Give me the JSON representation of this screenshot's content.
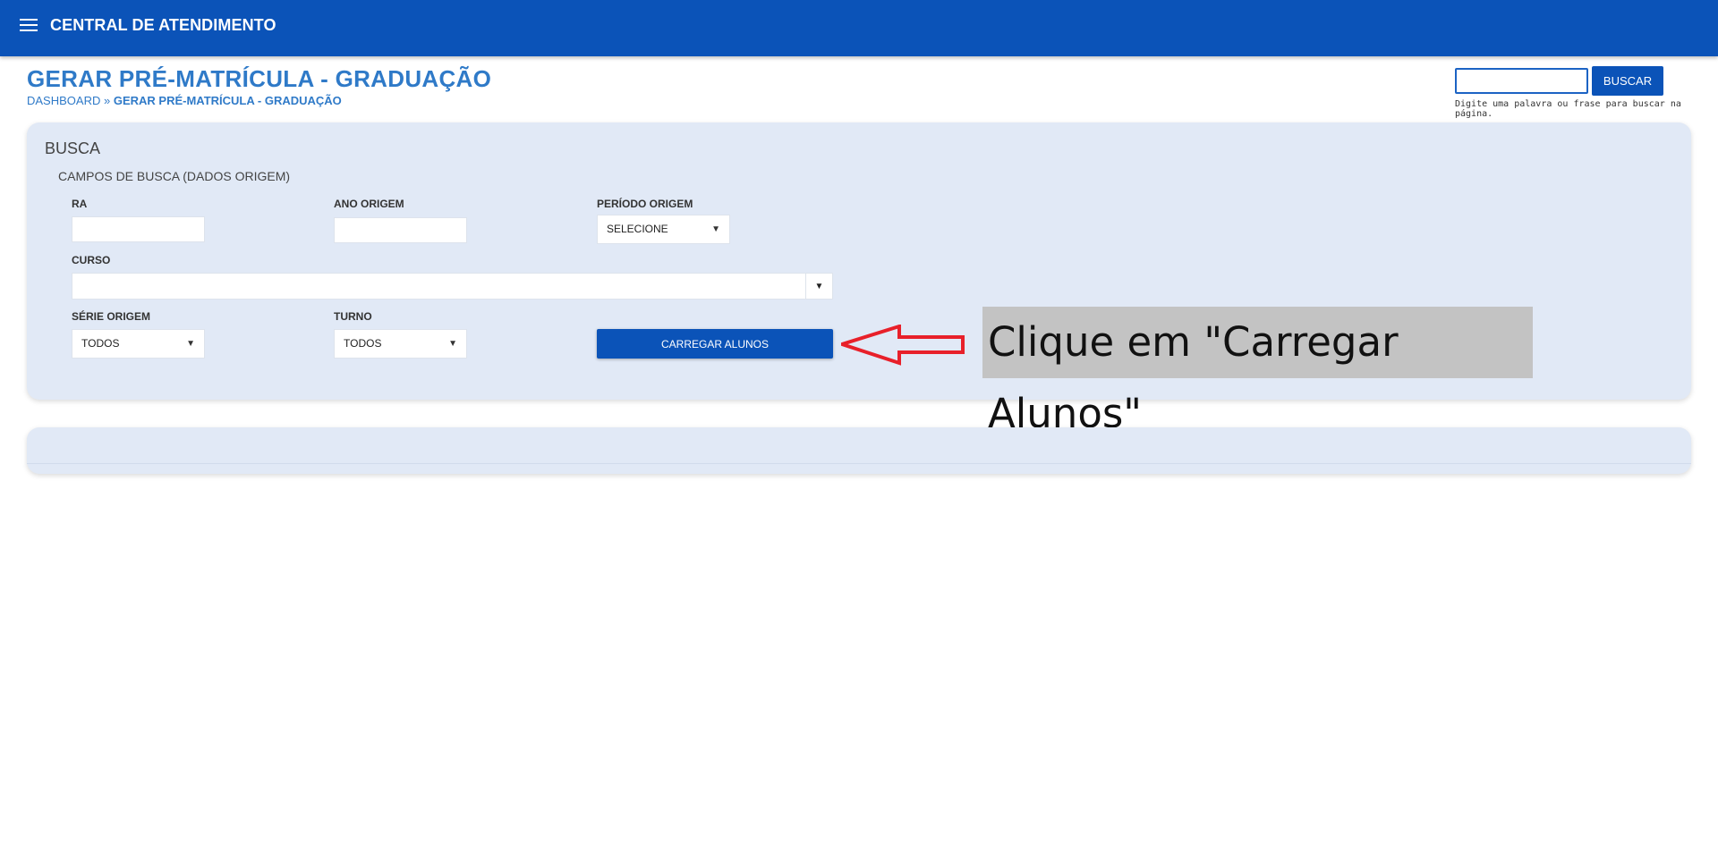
{
  "header": {
    "app_title": "CENTRAL DE ATENDIMENTO",
    "menu_icon": "hamburger-menu-icon"
  },
  "page": {
    "title": "GERAR PRÉ-MATRÍCULA - GRADUAÇÃO",
    "breadcrumb": {
      "home": "DASHBOARD",
      "separator": "»",
      "current": "GERAR PRÉ-MATRÍCULA - GRADUAÇÃO"
    }
  },
  "search": {
    "value": "",
    "button_label": "BUSCAR",
    "hint": "Digite uma palavra ou frase para buscar na página."
  },
  "busca_card": {
    "title": "BUSCA",
    "legend": "CAMPOS DE BUSCA (DADOS ORIGEM)",
    "fields": {
      "ra": {
        "label": "RA",
        "value": ""
      },
      "ano_origem": {
        "label": "ANO ORIGEM",
        "value": ""
      },
      "periodo_origem": {
        "label": "PERÍODO ORIGEM",
        "selected": "SELECIONE"
      },
      "curso": {
        "label": "CURSO",
        "selected": ""
      },
      "serie_origem": {
        "label": "SÉRIE ORIGEM",
        "selected": "TODOS"
      },
      "turno": {
        "label": "TURNO",
        "selected": "TODOS"
      }
    },
    "submit_label": "CARREGAR ALUNOS"
  },
  "annotation": {
    "text": "Clique em \"Carregar Alunos\"",
    "arrow_color": "#e8202a"
  },
  "colors": {
    "primary": "#0b53b8",
    "title_blue": "#2f7ac8",
    "card_bg": "#e1e9f6"
  }
}
